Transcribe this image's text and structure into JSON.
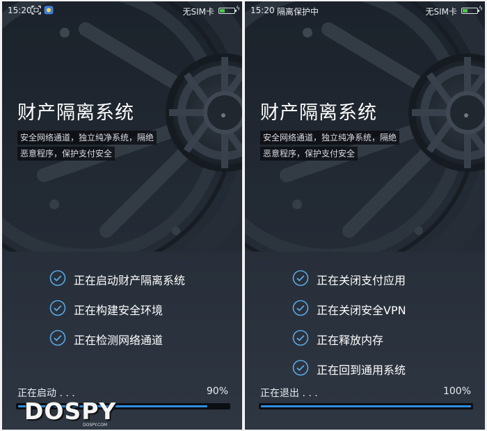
{
  "screens": [
    {
      "status": {
        "time": "15:20",
        "extra_text": "",
        "sim": "无SIM卡",
        "battery_percent": 40
      },
      "title": "财产隔离系统",
      "description": [
        "安全网络通道，独立纯净系统，隔绝",
        "恶意程序，保护支付安全"
      ],
      "steps": [
        {
          "label": "正在启动财产隔离系统",
          "icon": "check-circle-icon"
        },
        {
          "label": "正在构建安全环境",
          "icon": "check-circle-icon"
        },
        {
          "label": "正在检测网络通道",
          "icon": "check-circle-icon"
        }
      ],
      "progress": {
        "label": "正在启动 . . .",
        "value_text": "90%",
        "percent": 90
      }
    },
    {
      "status": {
        "time": "15:20",
        "extra_text": "隔离保护中",
        "sim": "无SIM卡",
        "battery_percent": 40
      },
      "title": "财产隔离系统",
      "description": [
        "安全网络通道，独立纯净系统，隔绝",
        "恶意程序，保护支付安全"
      ],
      "steps": [
        {
          "label": "正在关闭支付应用",
          "icon": "check-circle-icon"
        },
        {
          "label": "正在关闭安全VPN",
          "icon": "check-circle-icon"
        },
        {
          "label": "正在释放内存",
          "icon": "check-circle-icon"
        },
        {
          "label": "正在回到通用系统",
          "icon": "check-circle-icon"
        }
      ],
      "progress": {
        "label": "正在退出 . . .",
        "value_text": "100%",
        "percent": 100
      }
    }
  ],
  "watermark": {
    "text": "DOSPY",
    "sub": "DOSPY.COM"
  },
  "colors": {
    "accent": "#2f8fe0",
    "check": "#5aa9e6",
    "background_top": "#1c222b",
    "background_bottom": "#2e3642"
  }
}
